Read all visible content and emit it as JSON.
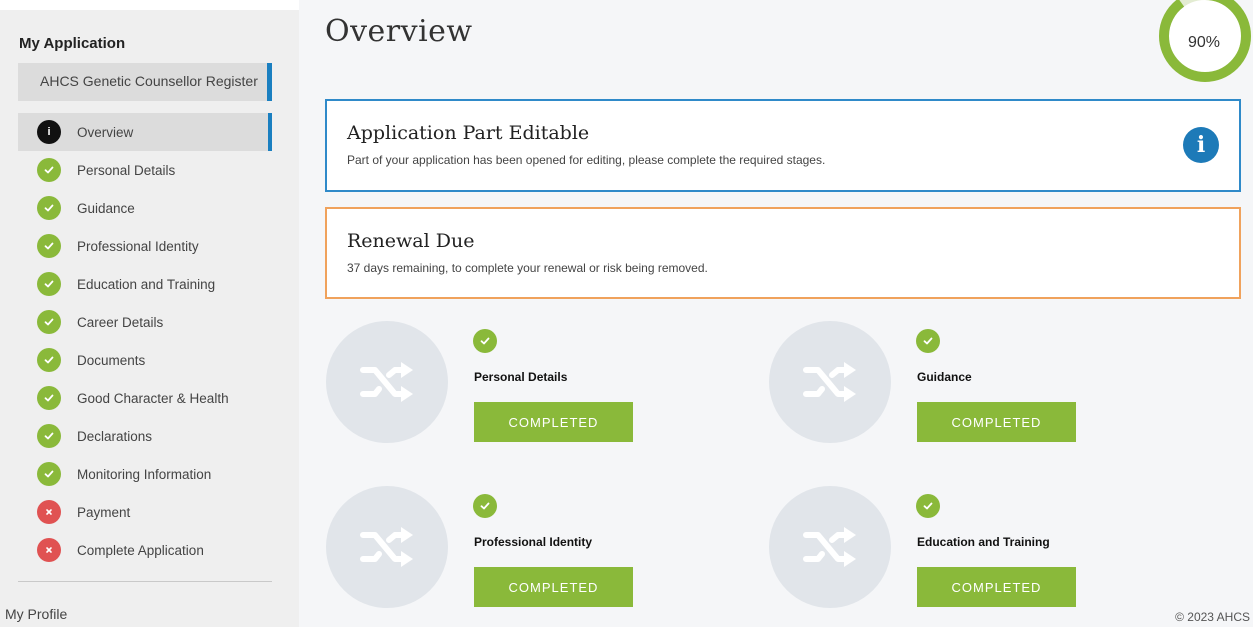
{
  "sidebar": {
    "title": "My Application",
    "register": "AHCS Genetic Counsellor Register",
    "items": [
      {
        "label": "Overview",
        "status": "info"
      },
      {
        "label": "Personal Details",
        "status": "done"
      },
      {
        "label": "Guidance",
        "status": "done"
      },
      {
        "label": "Professional Identity",
        "status": "done"
      },
      {
        "label": "Education and Training",
        "status": "done"
      },
      {
        "label": "Career Details",
        "status": "done"
      },
      {
        "label": "Documents",
        "status": "done"
      },
      {
        "label": "Good Character & Health",
        "status": "done"
      },
      {
        "label": "Declarations",
        "status": "done"
      },
      {
        "label": "Monitoring Information",
        "status": "done"
      },
      {
        "label": "Payment",
        "status": "fail"
      },
      {
        "label": "Complete Application",
        "status": "fail"
      }
    ],
    "my_profile": "My Profile"
  },
  "main": {
    "title": "Overview",
    "progress": {
      "percent": 90,
      "label": "90%"
    },
    "alerts": [
      {
        "title": "Application Part Editable",
        "body": "Part of your application has been opened for editing, please complete the required stages.",
        "color": "#2f8ac9"
      },
      {
        "title": "Renewal Due",
        "body": "37 days remaining, to complete your renewal or risk being removed.",
        "color": "#f0a25c"
      }
    ],
    "stages": [
      {
        "name": "Personal Details",
        "button": "COMPLETED"
      },
      {
        "name": "Guidance",
        "button": "COMPLETED"
      },
      {
        "name": "Professional Identity",
        "button": "COMPLETED"
      },
      {
        "name": "Education and Training",
        "button": "COMPLETED"
      }
    ]
  },
  "footer": {
    "copyright": "© 2023 AHCS"
  },
  "colors": {
    "accent": "#1a7fc0",
    "success": "#8ab93a",
    "error": "#e05252",
    "info": "#1d7ab8"
  },
  "icons": {
    "done": "check-icon",
    "fail": "cross-icon",
    "info": "info-icon",
    "stage": "shuffle-icon"
  }
}
